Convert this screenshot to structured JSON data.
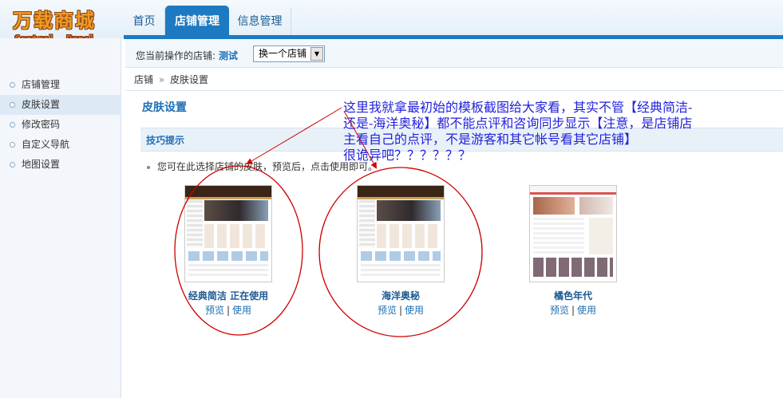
{
  "logo": {
    "line1": "万载商城",
    "line2": "Control  Panel"
  },
  "nav": {
    "tabs": [
      "首页",
      "店铺管理",
      "信息管理"
    ],
    "active_index": 1,
    "accent_color": "#1d7ac2"
  },
  "toolbar": {
    "current_store_label": "您当前操作的店铺:",
    "store_name": "测试",
    "switch_label": "换一个店铺"
  },
  "sidebar": {
    "items": [
      {
        "label": "店铺管理",
        "active": false
      },
      {
        "label": "皮肤设置",
        "active": true
      },
      {
        "label": "修改密码",
        "active": false
      },
      {
        "label": "自定义导航",
        "active": false
      },
      {
        "label": "地图设置",
        "active": false
      }
    ]
  },
  "breadcrumb": {
    "items": [
      "店铺",
      "皮肤设置"
    ],
    "separator": "»"
  },
  "main": {
    "page_title": "皮肤设置",
    "tip_header": "技巧提示",
    "tip_text": "您可在此选择店铺的皮肤，预览后，点击使用即可。",
    "skins": [
      {
        "name": "经典简洁 正在使用",
        "preview": "预览",
        "use": "使用",
        "theme": "dark-header"
      },
      {
        "name": "海洋奥秘",
        "preview": "预览",
        "use": "使用",
        "theme": "dark-header"
      },
      {
        "name": "橘色年代",
        "preview": "预览",
        "use": "使用",
        "theme": "light-photo"
      }
    ]
  },
  "annotation": {
    "lines": [
      "这里我就拿最初始的模板截图给大家看，其实不管【经典简洁-",
      "还是-海洋奥秘】都不能点评和咨询同步显示【注意，是店铺店",
      "主看自己的点评，不是游客和其它帐号看其它店铺】",
      "很诡异吧？？？？？？"
    ],
    "color": "#2222dd",
    "circle_color": "#cc0000"
  }
}
